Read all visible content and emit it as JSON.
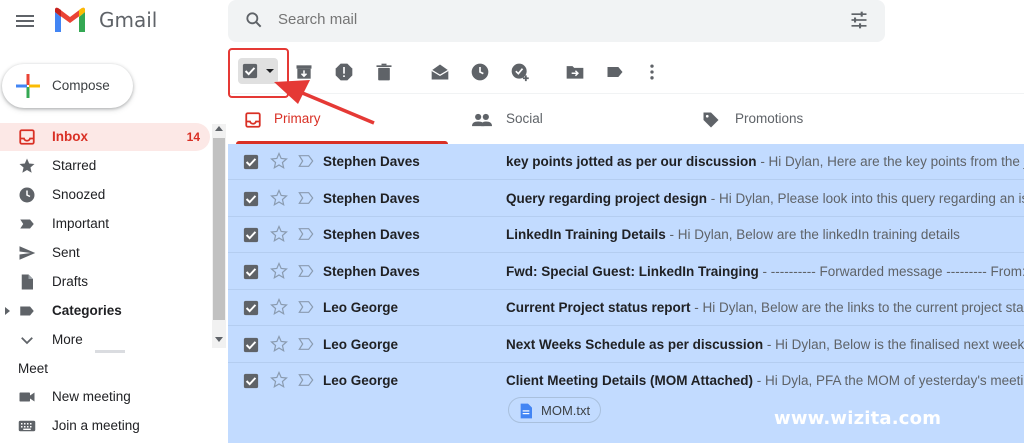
{
  "app": {
    "brand": "Gmail"
  },
  "search": {
    "placeholder": "Search mail"
  },
  "compose": {
    "label": "Compose"
  },
  "sidebar": {
    "items": [
      {
        "label": "Inbox",
        "count": "14",
        "icon": "inbox-icon"
      },
      {
        "label": "Starred",
        "icon": "star-icon"
      },
      {
        "label": "Snoozed",
        "icon": "clock-icon"
      },
      {
        "label": "Important",
        "icon": "important-icon"
      },
      {
        "label": "Sent",
        "icon": "send-icon"
      },
      {
        "label": "Drafts",
        "icon": "draft-icon"
      },
      {
        "label": "Categories",
        "icon": "label-icon"
      },
      {
        "label": "More",
        "icon": "chevron-down-icon"
      }
    ]
  },
  "meet": {
    "heading": "Meet",
    "items": [
      {
        "label": "New meeting",
        "icon": "videocam-icon"
      },
      {
        "label": "Join a meeting",
        "icon": "keyboard-icon"
      }
    ]
  },
  "tabs": [
    {
      "label": "Primary",
      "icon": "inbox-icon",
      "active": true
    },
    {
      "label": "Social",
      "icon": "people-icon"
    },
    {
      "label": "Promotions",
      "icon": "tag-icon"
    }
  ],
  "emails": [
    {
      "sender": "Stephen Daves",
      "subject": "key points jotted as per our discussion",
      "snippet": " - Hi Dylan, Here are the key points from the journal"
    },
    {
      "sender": "Stephen Daves",
      "subject": "Query regarding project design",
      "snippet": " - Hi Dylan, Please look into this query regarding an issue in the"
    },
    {
      "sender": "Stephen Daves",
      "subject": "LinkedIn Training Details",
      "snippet": " - Hi Dylan, Below are the linkedIn training details"
    },
    {
      "sender": "Stephen Daves",
      "subject": "Fwd: Special Guest: LinkedIn Trainging",
      "snippet": " - ---------- Forwarded message --------- From: Eric Lou"
    },
    {
      "sender": "Leo George",
      "subject": "Current Project status report",
      "snippet": " - Hi Dylan, Below are the links to the current project status repo"
    },
    {
      "sender": "Leo George",
      "subject": "Next Weeks Schedule as per discussion",
      "snippet": " - Hi Dylan, Below is the finalised next week schedule"
    },
    {
      "sender": "Leo George",
      "subject": "Client Meeting Details (MOM Attached)",
      "snippet": " - Hi Dyla, PFA the MOM of yesterday's meeting with"
    }
  ],
  "attachment": {
    "name": "MOM.txt"
  },
  "watermark": "www.wizita.com",
  "colors": {
    "accent": "#d93025",
    "selected_row": "#c2dbff",
    "annotation": "#e53935"
  }
}
